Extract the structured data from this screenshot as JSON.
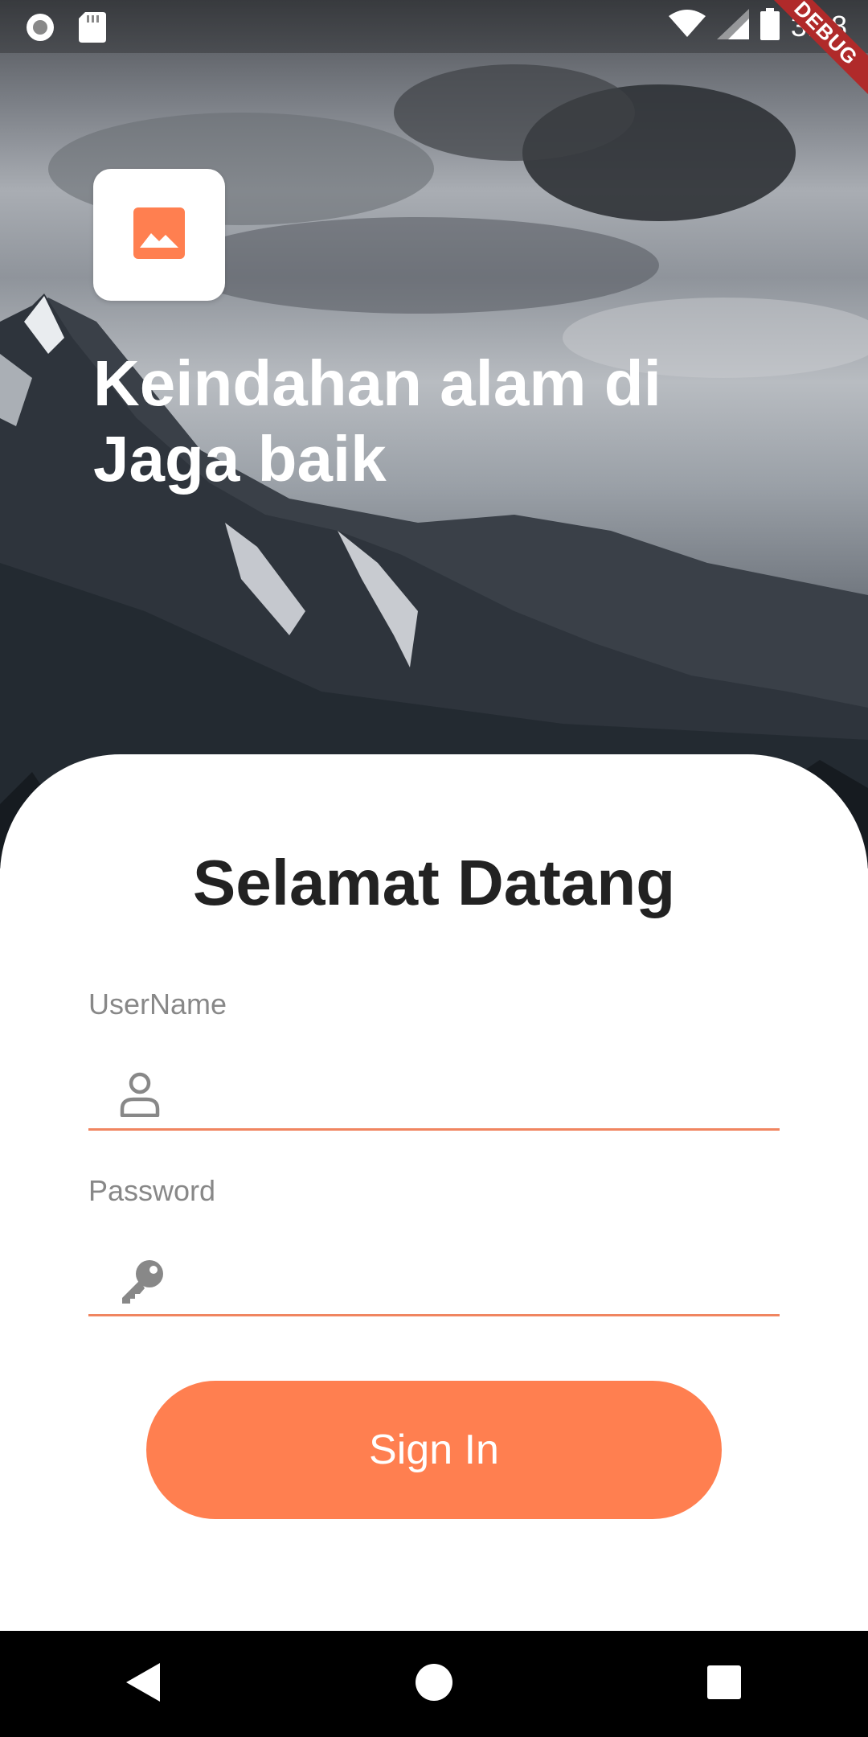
{
  "status_bar": {
    "time": "3:28",
    "debug_label": "DEBUG"
  },
  "hero": {
    "title_line1": "Keindahan alam di",
    "title_line2": "Jaga baik"
  },
  "card": {
    "welcome": "Selamat Datang"
  },
  "form": {
    "username_label": "UserName",
    "username_value": "",
    "password_label": "Password",
    "password_value": ""
  },
  "signin_label": "Sign In",
  "colors": {
    "accent": "#ff7f50",
    "underline": "#f08560",
    "label": "#888888"
  },
  "icons": [
    "image-icon",
    "user-icon",
    "key-icon",
    "back-icon",
    "home-icon",
    "recents-icon"
  ]
}
